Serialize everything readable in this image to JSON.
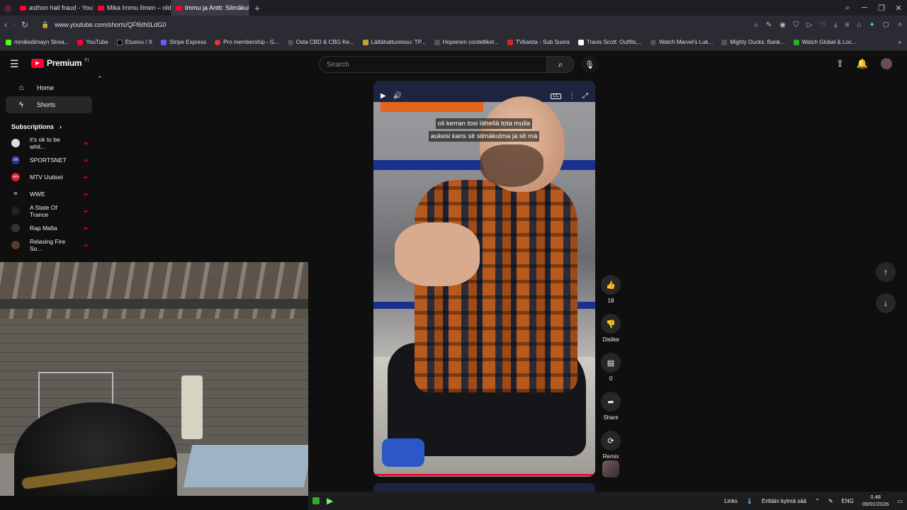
{
  "browser": {
    "tabs": [
      {
        "title": "asthon hall fraud - YouTube",
        "active": false
      },
      {
        "title": "Mika Immu Ilmen – old s...",
        "active": false
      },
      {
        "title": "Immu ja Antti: Silmäkulm...",
        "active": true
      }
    ],
    "url": "www.youtube.com/shorts/QFf6th0LdG0",
    "bookmarks": [
      "mmikedimayn Strea...",
      "YouTube",
      "Etusivu / X",
      "Stripe Express",
      "Pro membership - G...",
      "Osta CBD & CBG Ke...",
      "Lättähattureissu: TP...",
      "Hopeinen cordelliket...",
      "TVkaista - Sub Suora",
      "Travis Scott: Outfits,...",
      "Watch Marvel's Luk...",
      "Mighty Ducks: Bank...",
      "Watch Global & Loc..."
    ]
  },
  "youtube": {
    "logo_text": "Premium",
    "country_code": "FI",
    "search_placeholder": "Search",
    "sidebar": {
      "items": [
        {
          "label": "Home",
          "icon": "home-icon",
          "active": false
        },
        {
          "label": "Shorts",
          "icon": "shorts-icon",
          "active": true
        }
      ],
      "subscriptions_label": "Subscriptions",
      "subscriptions": [
        {
          "name": "it's ok to be whit...",
          "avatar": ""
        },
        {
          "name": "SPORTSNET",
          "avatar": "SN"
        },
        {
          "name": "MTV Uutiset",
          "avatar": "mtv"
        },
        {
          "name": "WWE",
          "avatar": "W"
        },
        {
          "name": "A State Of Trance",
          "avatar": ""
        },
        {
          "name": "Rap Mafia",
          "avatar": ""
        },
        {
          "name": "Relaxing Fire So...",
          "avatar": ""
        }
      ]
    },
    "short": {
      "caption_line1": "oli kerran tosi lähellä tota mulla",
      "caption_line2": "aukesi kans sit silmäkulma ja sit mä",
      "cc_label": "CC"
    },
    "actions": {
      "like_count": "18",
      "dislike_label": "Dislike",
      "comment_count": "0",
      "share_label": "Share",
      "remix_label": "Remix"
    }
  },
  "taskbar": {
    "links_label": "Links",
    "weather": "Erittäin kylmä sää",
    "language": "ENG",
    "time": "0.48",
    "date": "09/01/2026"
  }
}
